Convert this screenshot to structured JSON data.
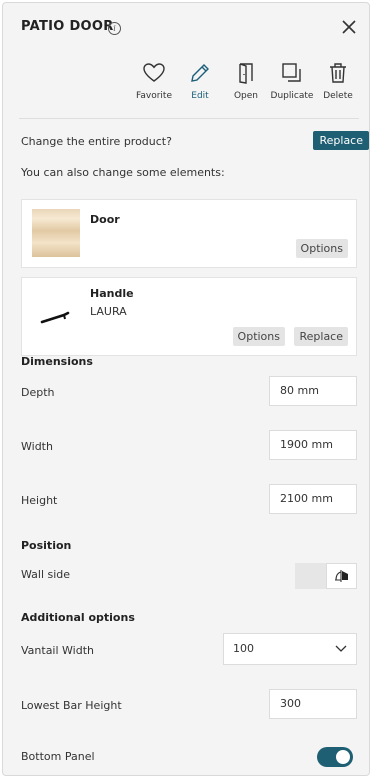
{
  "header": {
    "title": "PATIO DOOR",
    "info_icon": "info-icon",
    "close_icon": "close-icon"
  },
  "actions": [
    {
      "label": "Favorite",
      "icon": "heart-icon"
    },
    {
      "label": "Edit",
      "icon": "pencil-icon",
      "active": true
    },
    {
      "label": "Open",
      "icon": "door-open-icon"
    },
    {
      "label": "Duplicate",
      "icon": "duplicate-icon"
    },
    {
      "label": "Delete",
      "icon": "trash-icon"
    }
  ],
  "product": {
    "change_entire_text": "Change the entire product?",
    "replace_label": "Replace",
    "change_elements_text": "You can also change some elements:"
  },
  "elements": [
    {
      "name": "Door",
      "sub": "",
      "options_label": "Options"
    },
    {
      "name": "Handle",
      "sub": "LAURA",
      "options_label": "Options",
      "replace_label": "Replace"
    }
  ],
  "dimensions": {
    "heading": "Dimensions",
    "fields": [
      {
        "label": "Depth",
        "value": "80 mm"
      },
      {
        "label": "Width",
        "value": "1900 mm"
      },
      {
        "label": "Height",
        "value": "2100 mm"
      }
    ]
  },
  "position": {
    "heading": "Position",
    "wall_side_label": "Wall side"
  },
  "additional": {
    "heading": "Additional options",
    "vantail_width_label": "Vantail Width",
    "vantail_width_value": "100",
    "lowest_bar_label": "Lowest Bar Height",
    "lowest_bar_value": "300",
    "bottom_panel_label": "Bottom Panel",
    "bottom_panel_on": true
  },
  "colors": {
    "accent": "#1f5f73",
    "panel_bg": "#f4f4f4"
  }
}
